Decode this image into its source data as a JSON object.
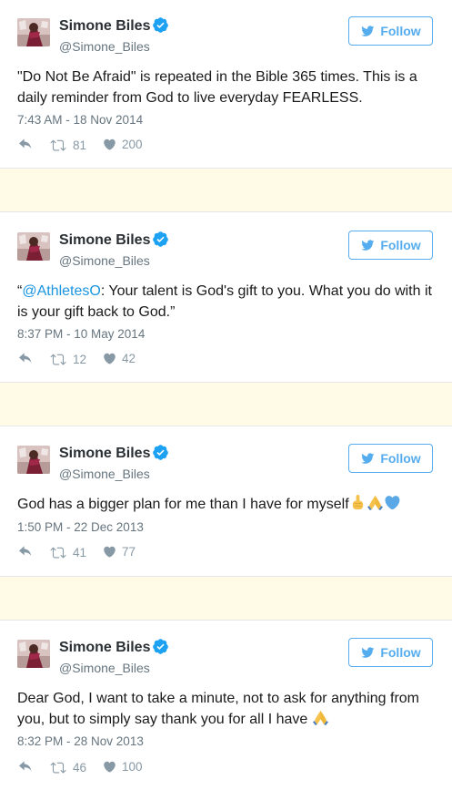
{
  "tweets": [
    {
      "name": "Simone Biles",
      "handle": "@Simone_Biles",
      "follow_label": "Follow",
      "text": "\"Do Not Be Afraid\" is repeated in the Bible 365 times. This is a daily reminder from God to live everyday FEARLESS.",
      "time": "7:43 AM - 18 Nov 2014",
      "retweets": "81",
      "likes": "200"
    },
    {
      "name": "Simone Biles",
      "handle": "@Simone_Biles",
      "follow_label": "Follow",
      "text_prefix": "“",
      "mention": "@AthletesO",
      "text_rest": ": Your talent is God's gift to you. What you do with it is your gift back to God.”",
      "time": "8:37 PM - 10 May 2014",
      "retweets": "12",
      "likes": "42"
    },
    {
      "name": "Simone Biles",
      "handle": "@Simone_Biles",
      "follow_label": "Follow",
      "text": "God has a bigger plan for me than I have for myself",
      "emojis": [
        "pointing-up-emoji",
        "praying-hands-emoji",
        "blue-heart-emoji"
      ],
      "time": "1:50 PM - 22 Dec 2013",
      "retweets": "41",
      "likes": "77"
    },
    {
      "name": "Simone Biles",
      "handle": "@Simone_Biles",
      "follow_label": "Follow",
      "text": "Dear God, I want to take a minute, not to ask for anything from you, but to simply say thank you for all I have",
      "emojis": [
        "praying-hands-emoji"
      ],
      "time": "8:32 PM - 28 Nov 2013",
      "retweets": "46",
      "likes": "100"
    }
  ],
  "colors": {
    "accent": "#55acee",
    "mention": "#1b95e0",
    "gap_background": "#fffbe6",
    "meta_text": "#66757f"
  }
}
